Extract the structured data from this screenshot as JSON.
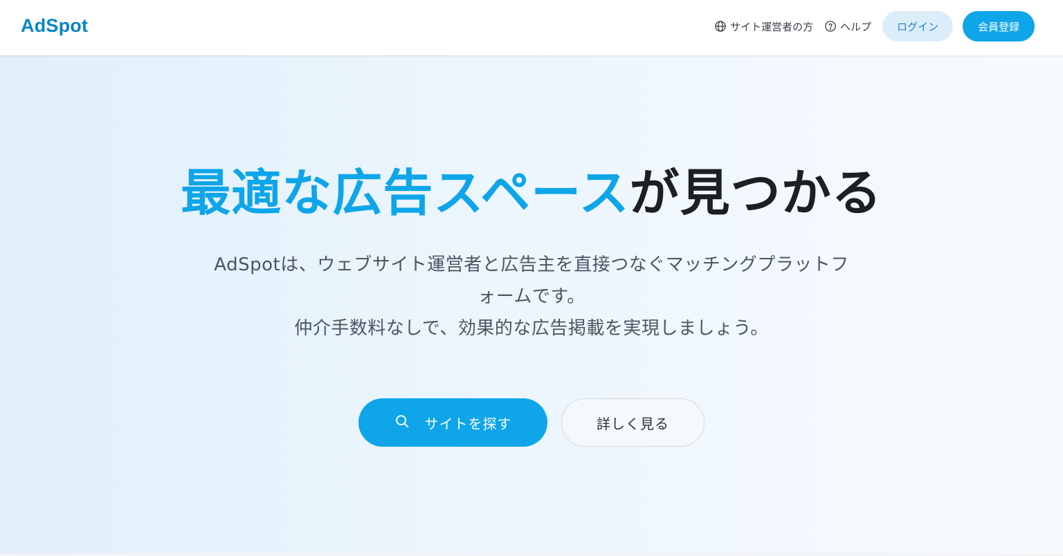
{
  "header": {
    "logo": "AdSpot",
    "nav": {
      "site_owner_label": "サイト運営者の方",
      "site_owner_icon": "globe-icon",
      "help_label": "ヘルプ",
      "help_icon": "question-circle-icon",
      "login_label": "ログイン",
      "register_label": "会員登録"
    }
  },
  "hero": {
    "headline_accent": "最適な広告スペース",
    "headline_rest": "が見つかる",
    "description_line1": "AdSpotは、ウェブサイト運営者と広告主を直接つなぐマッチングプラットフォームです。",
    "description_line2": "仲介手数料なしで、効果的な広告掲載を実現しましょう。",
    "search_button_label": "サイトを探す",
    "search_button_icon": "search-icon",
    "more_button_label": "詳しく見る"
  },
  "colors": {
    "brand": "#0a84c6",
    "accent": "#0ea5e9",
    "login_bg": "#dcedfa",
    "hero_gradient_start": "#e1f0fb",
    "hero_gradient_end": "#f8fbfe",
    "text_dark": "#1c1f24",
    "text_muted": "#4b5563"
  }
}
